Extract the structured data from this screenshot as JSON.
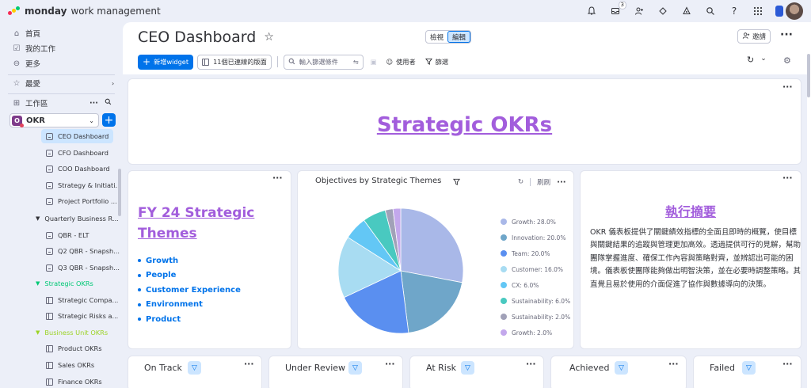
{
  "topbar": {
    "brand_strong": "monday",
    "brand_light": "work management",
    "inbox_badge": "3",
    "icons": [
      "bell-icon",
      "inbox-icon",
      "invite-members-icon",
      "integrations-icon",
      "marketplace-icon",
      "search-icon",
      "help-icon",
      "apps-grid-icon",
      "avatar"
    ]
  },
  "sidebar": {
    "home": "首頁",
    "my_work": "我的工作",
    "more": "更多",
    "favorites": "最愛",
    "workspaces": "工作區",
    "workspace_name": "OKR",
    "workspace_badge": "O",
    "items": [
      {
        "label": "CEO Dashboard",
        "type": "dashboard",
        "active": true
      },
      {
        "label": "CFO Dashboard",
        "type": "dashboard"
      },
      {
        "label": "COO Dashboard",
        "type": "dashboard"
      },
      {
        "label": "Strategy & Initiati...",
        "type": "dashboard"
      },
      {
        "label": "Project Portfolio ...",
        "type": "dashboard"
      }
    ],
    "folder_quarterly": "Quarterly Business R...",
    "quarterly_items": [
      {
        "label": "QBR - ELT",
        "type": "dashboard"
      },
      {
        "label": "Q2 QBR - Snapsh...",
        "type": "dashboard"
      },
      {
        "label": "Q3 QBR - Snapsh...",
        "type": "dashboard"
      }
    ],
    "folder_strategic": "Strategic OKRs",
    "strategic_items": [
      {
        "label": "Strategic Compa...",
        "type": "board"
      },
      {
        "label": "Strategic Risks a...",
        "type": "board"
      }
    ],
    "folder_business": "Business Unit OKRs",
    "business_items": [
      {
        "label": "Product OKRs",
        "type": "board"
      },
      {
        "label": "Sales OKRs",
        "type": "board"
      },
      {
        "label": "Finance OKRs",
        "type": "board"
      }
    ],
    "colors": {
      "strategic_folder": "#00c875",
      "business_folder": "#9cd326"
    }
  },
  "header": {
    "title": "CEO Dashboard",
    "mode_view": "檢視",
    "mode_edit": "編輯",
    "invite": "邀請"
  },
  "toolbar": {
    "new_widget": "新增widget",
    "connected_boards": "11個已連線的版面",
    "search_placeholder": "輸入篩選條件",
    "person": "使用者",
    "filter": "篩選"
  },
  "widgets": {
    "strategic_okrs": "Strategic OKRs",
    "fy_title": "FY 24 Strategic Themes",
    "fy_items": [
      "Growth",
      "People",
      "Customer Experience",
      "Environment",
      "Product"
    ],
    "chart_title": "Objectives by Strategic Themes",
    "chart_refresh": "刷刷",
    "exec_title": "執行摘要",
    "exec_body": "OKR 儀表板提供了關鍵績效指標的全面且即時的概覽，使目標與關鍵結果的追蹤與管理更加高效。透過提供可行的見解，幫助團隊掌握進度、確保工作內容與策略對齊，並辨認出可能的困境。儀表板使團隊能夠做出明智決策，並在必要時調整策略。其直覺且易於使用的介面促進了協作與數據導向的決策。",
    "statuses": [
      "On Track",
      "Under Review",
      "At Risk",
      "Achieved",
      "Failed"
    ]
  },
  "chart_data": {
    "type": "pie",
    "title": "Objectives by Strategic Themes",
    "series": [
      {
        "values": [
          28.0,
          20.0,
          20.0,
          16.0,
          6.0,
          6.0,
          2.0,
          2.0
        ]
      }
    ],
    "categories": [
      "Growth",
      "Innovation",
      "Team",
      "Customer",
      "CX",
      "Sustainability",
      "Sustainability",
      "Growth"
    ],
    "legend_labels": [
      "Growth: 28.0%",
      "Innovation: 20.0%",
      "Team: 20.0%",
      "Customer: 16.0%",
      "CX: 6.0%",
      "Sustainability: 6.0%",
      "Sustainability: 2.0%",
      "Growth: 2.0%"
    ],
    "colors": [
      "#a9b8e8",
      "#6fa6c9",
      "#5a8ff0",
      "#a8dcf2",
      "#63c7f5",
      "#49c9c0",
      "#a1a1b8",
      "#c3a8ec"
    ],
    "legend_position": "right"
  }
}
